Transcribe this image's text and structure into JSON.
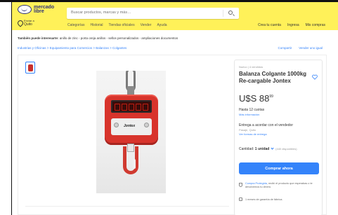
{
  "header": {
    "logo_line1": "mercado",
    "logo_line2": "libre",
    "location_label": "Enviar a",
    "location_city": "Quito",
    "search_placeholder": "Buscar productos, marcas y más…",
    "nav": [
      "Categorías",
      "Historial",
      "Tiendas oficiales",
      "Vender",
      "Ayuda"
    ],
    "user_nav": [
      "Crea tu cuenta",
      "Ingresa",
      "Mis compras"
    ],
    "accent_color": "#fff159"
  },
  "related": {
    "prefix": "También puede interesarte:",
    "items": "anillo de zinc - porta oreja anillos - sellos personalizados - ampliaciones documentos"
  },
  "breadcrumb": "Industrias y Oficinas  >  Equipamiento para Comercios  >  Balanzas  >  Colgantes",
  "share": {
    "compare": "Compartir",
    "sell_same": "Vender uno igual"
  },
  "product": {
    "condition": "Nuevo  |  4 vendidos",
    "title": "Balanza Colgante 1000kg Re-cargable Jontex",
    "price_main": "U$S 88",
    "price_cents": "99",
    "installments": "Hasta 12 cuotas",
    "more_info": "Más información",
    "delivery": "Entrega a acordar con el vendedor",
    "pickup": "Pasaje, Quito",
    "delivery_link": "Ver formas de entrega",
    "quantity_label": "Cantidad:",
    "quantity_value": "1 unidad",
    "available": "(440 disponibles)",
    "buy_label": "Comprar ahora",
    "protect_title": "Compra Protegida",
    "protect_text": ", recibí el producto que esperabas o te devolvemos tu dinero.",
    "warranty": "1 meses de garantía de fábrica.",
    "brand_on_scale": "Jontex",
    "brand_color": "#3483fa"
  }
}
